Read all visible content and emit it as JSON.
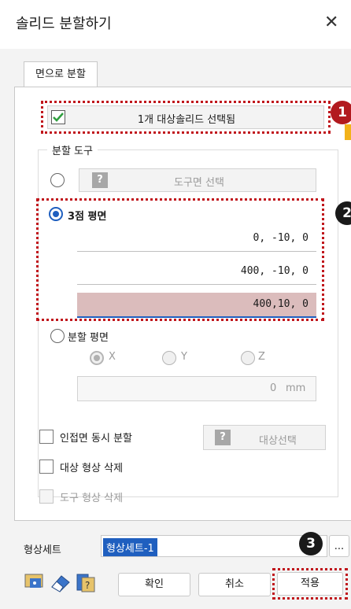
{
  "window": {
    "title": "솔리드 분할하기",
    "close_glyph": "✕"
  },
  "tab": {
    "label": "면으로 분할"
  },
  "target": {
    "label": "1개 대상솔리드 선택됨",
    "checked": true
  },
  "tool_group": {
    "title": "분할 도구",
    "tool_face_button": "도구면 선택",
    "three_point": {
      "label": "3점 평면",
      "selected": true,
      "points": [
        "0, -10, 0",
        "400, -10, 0",
        "400,10, 0"
      ]
    },
    "split_plane": {
      "label": "분할 평면",
      "axes": [
        "X",
        "Y",
        "Z"
      ],
      "selected_axis": "X",
      "value": "0",
      "unit": "mm"
    }
  },
  "options": {
    "adjacent_split": "인접면 동시 분할",
    "target_select_button": "대상선택",
    "delete_target": "대상 형상 삭제",
    "delete_tool": "도구 형상 삭제"
  },
  "shape_set": {
    "label": "형상세트",
    "value": "형상세트-1",
    "browse": "..."
  },
  "footer": {
    "confirm": "확인",
    "cancel": "취소",
    "apply": "적용"
  },
  "badges": [
    "1",
    "2",
    "3"
  ],
  "colors": {
    "highlight": "#c0151b",
    "accent": "#1f5fbf",
    "selected_field": "#dbbcbc",
    "check_green": "#2e9e3e"
  }
}
